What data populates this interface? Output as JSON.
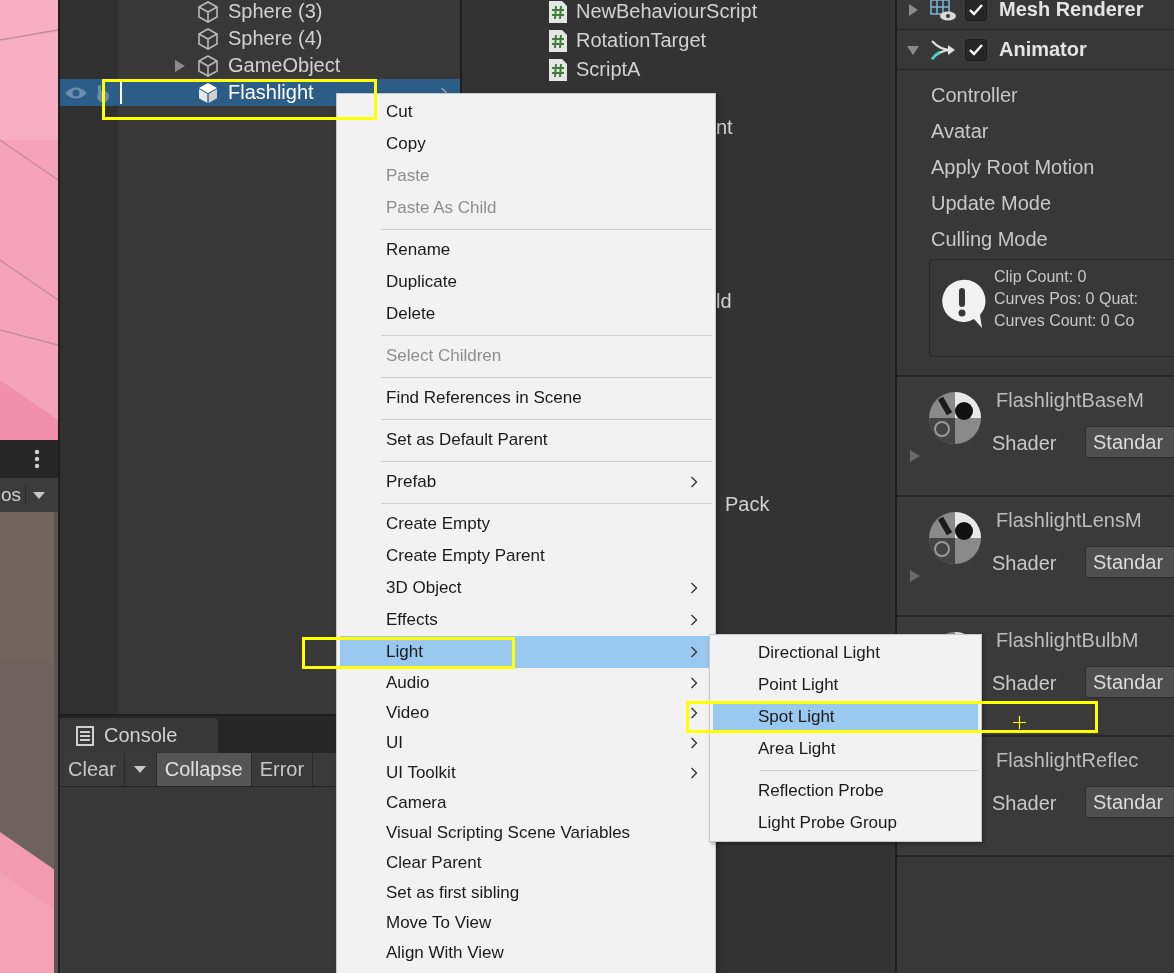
{
  "scene_view": {
    "toolbar_text": "os"
  },
  "hierarchy": {
    "rows": [
      {
        "name": "Sphere (3)",
        "kind": "object",
        "expandable": false,
        "selected": false,
        "show_toggles": false
      },
      {
        "name": "Sphere (4)",
        "kind": "object",
        "expandable": false,
        "selected": false,
        "show_toggles": false
      },
      {
        "name": "GameObject",
        "kind": "object",
        "expandable": true,
        "selected": false,
        "show_toggles": false
      },
      {
        "name": "Flashlight",
        "kind": "prefab",
        "expandable": false,
        "selected": true,
        "show_toggles": true
      }
    ]
  },
  "console": {
    "tab": "Console",
    "buttons": [
      {
        "label": "Clear",
        "kind": "button"
      },
      {
        "kind": "dropdown"
      },
      {
        "label": "Collapse",
        "kind": "toggle",
        "on": true
      },
      {
        "label": "Error",
        "kind": "toggle",
        "on": false
      }
    ]
  },
  "project": {
    "items": [
      {
        "name": "NewBehaviourScript",
        "kind": "script"
      },
      {
        "name": "RotationTarget",
        "kind": "script"
      },
      {
        "name": "ScriptA",
        "kind": "script"
      }
    ],
    "partial_items": [
      "nt",
      "ld",
      "Pack"
    ]
  },
  "inspector": {
    "components": [
      {
        "name": "Mesh Renderer",
        "kind": "mesh_renderer",
        "expanded": false,
        "enabled": true
      },
      {
        "name": "Animator",
        "kind": "animator",
        "expanded": true,
        "enabled": true
      }
    ],
    "fields": [
      "Controller",
      "Avatar",
      "Apply Root Motion",
      "Update Mode",
      "Culling Mode"
    ],
    "info": [
      "Clip Count: 0",
      "Curves Pos: 0 Quat:",
      "Curves Count: 0 Co"
    ],
    "materials": [
      {
        "name": "FlashlightBaseM",
        "shader_label": "Shader",
        "shader": "Standar",
        "preview_shown": true,
        "foldout_shown": true
      },
      {
        "name": "FlashlightLensM",
        "shader_label": "Shader",
        "shader": "Standar",
        "preview_shown": true,
        "foldout_shown": true
      },
      {
        "name": "FlashlightBulbM",
        "shader_label": "Shader",
        "shader": "Standar",
        "preview_shown": true,
        "foldout_shown": false
      },
      {
        "name": "FlashlightReflec",
        "shader_label": "Shader",
        "shader": "Standar"
      }
    ]
  },
  "context_menu": {
    "items": [
      {
        "kind": "item",
        "label": "Cut",
        "disabled": false,
        "submenu": false,
        "selected": false
      },
      {
        "kind": "item",
        "label": "Copy",
        "disabled": false,
        "submenu": false,
        "selected": false
      },
      {
        "kind": "item",
        "label": "Paste",
        "disabled": true,
        "submenu": false,
        "selected": false
      },
      {
        "kind": "item",
        "label": "Paste As Child",
        "disabled": true,
        "submenu": false,
        "selected": false
      },
      {
        "kind": "separator"
      },
      {
        "kind": "item",
        "label": "Rename",
        "disabled": false,
        "submenu": false,
        "selected": false
      },
      {
        "kind": "item",
        "label": "Duplicate",
        "disabled": false,
        "submenu": false,
        "selected": false
      },
      {
        "kind": "item",
        "label": "Delete",
        "disabled": false,
        "submenu": false,
        "selected": false
      },
      {
        "kind": "separator"
      },
      {
        "kind": "item",
        "label": "Select Children",
        "disabled": true,
        "submenu": false,
        "selected": false
      },
      {
        "kind": "separator"
      },
      {
        "kind": "item",
        "label": "Find References in Scene",
        "disabled": false,
        "submenu": false,
        "selected": false
      },
      {
        "kind": "separator"
      },
      {
        "kind": "item",
        "label": "Set as Default Parent",
        "disabled": false,
        "submenu": false,
        "selected": false
      },
      {
        "kind": "separator"
      },
      {
        "kind": "item",
        "label": "Prefab",
        "disabled": false,
        "submenu": true,
        "selected": false
      },
      {
        "kind": "separator"
      },
      {
        "kind": "item",
        "label": "Create Empty",
        "disabled": false,
        "submenu": false,
        "selected": false
      },
      {
        "kind": "item",
        "label": "Create Empty Parent",
        "disabled": false,
        "submenu": false,
        "selected": false
      },
      {
        "kind": "item",
        "label": "3D Object",
        "disabled": false,
        "submenu": true,
        "selected": false
      },
      {
        "kind": "item",
        "label": "Effects",
        "disabled": false,
        "submenu": true,
        "selected": false
      },
      {
        "kind": "item",
        "label": "Light",
        "disabled": false,
        "submenu": true,
        "selected": true
      },
      {
        "kind": "item",
        "label": "Audio",
        "disabled": false,
        "submenu": true,
        "selected": false
      },
      {
        "kind": "item",
        "label": "Video",
        "disabled": false,
        "submenu": true,
        "selected": false
      },
      {
        "kind": "item",
        "label": "UI",
        "disabled": false,
        "submenu": true,
        "selected": false
      },
      {
        "kind": "item",
        "label": "UI Toolkit",
        "disabled": false,
        "submenu": true,
        "selected": false
      },
      {
        "kind": "item",
        "label": "Camera",
        "disabled": false,
        "submenu": false,
        "selected": false
      },
      {
        "kind": "item",
        "label": "Visual Scripting Scene Variables",
        "disabled": false,
        "submenu": false,
        "selected": false
      },
      {
        "kind": "item",
        "label": "Clear Parent",
        "disabled": false,
        "submenu": false,
        "selected": false
      },
      {
        "kind": "item",
        "label": "Set as first sibling",
        "disabled": false,
        "submenu": false,
        "selected": false
      },
      {
        "kind": "item",
        "label": "Move To View",
        "disabled": false,
        "submenu": false,
        "selected": false
      },
      {
        "kind": "item",
        "label": "Align With View",
        "disabled": false,
        "submenu": false,
        "selected": false
      }
    ]
  },
  "submenu": {
    "items": [
      {
        "kind": "item",
        "label": "Directional Light",
        "selected": false
      },
      {
        "kind": "item",
        "label": "Point Light",
        "selected": false
      },
      {
        "kind": "item",
        "label": "Spot Light",
        "selected": true
      },
      {
        "kind": "item",
        "label": "Area Light",
        "selected": false
      },
      {
        "kind": "separator"
      },
      {
        "kind": "item",
        "label": "Reflection Probe",
        "selected": false
      },
      {
        "kind": "item",
        "label": "Light Probe Group",
        "selected": false
      }
    ]
  }
}
